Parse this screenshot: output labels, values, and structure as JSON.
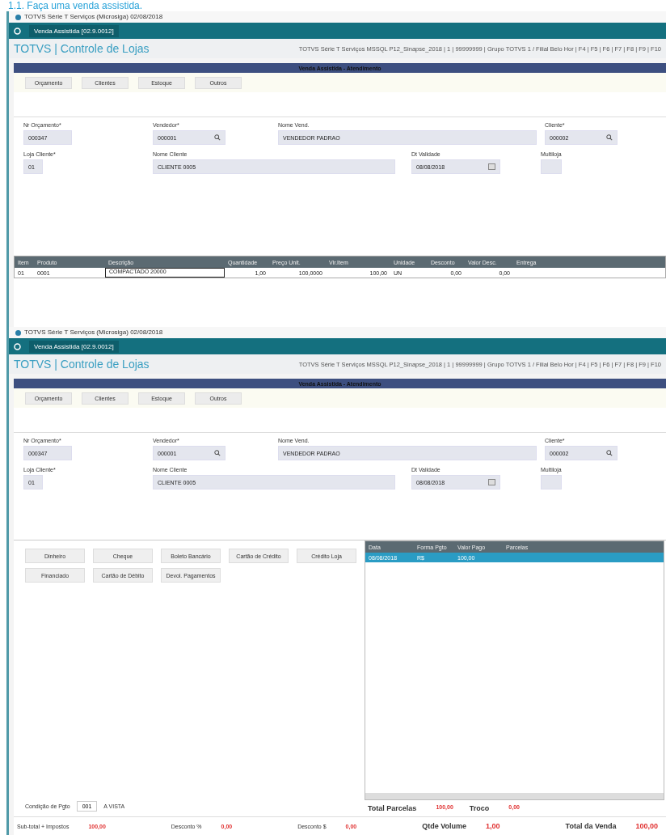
{
  "caption": "1.1. Faça uma venda assistida.",
  "screens": [
    {
      "window_title": "TOTVS Série T Serviços (Microsiga) 02/08/2018",
      "tab": "Venda Assistida [02.9.0012]",
      "app_title": "TOTVS | Controle de Lojas",
      "environment": "TOTVS Série T Serviços MSSQL P12_Sinapse_2018 | 1 | 99999999 | Grupo TOTVS 1 / Filial Belo Hor | F4 | F5 | F6 | F7 | F8 | F9 | F10",
      "dialog_title": "Venda Assistida - Atendimento",
      "toolbar": [
        "Orçamento",
        "Clientes",
        "Estoque",
        "Outros"
      ],
      "field_rows": [
        [
          {
            "label": "Nr Orçamento*",
            "value": "000347",
            "kind": "text"
          },
          {
            "label": "Vendedor*",
            "value": "000001",
            "kind": "lookup"
          },
          {
            "label": "Nome Vend.",
            "value": "VENDEDOR PADRAO",
            "kind": "text"
          },
          {
            "label": "Cliente*",
            "value": "000002",
            "kind": "lookup"
          }
        ],
        [
          {
            "label": "Loja Cliente*",
            "value": "01",
            "kind": "text"
          },
          {
            "label": "Nome Cliente",
            "value": "CLIENTE 0005",
            "kind": "text"
          },
          {
            "label": "Dt Validade",
            "value": "08/08/2018",
            "kind": "date"
          },
          {
            "label": "Multiloja",
            "kind": "text"
          }
        ]
      ],
      "items_table": {
        "columns": [
          "Item",
          "Produto",
          "Descrição",
          "Quantidade",
          "Preço Unit.",
          "Vlr.Item",
          "Unidade",
          "Desconto",
          "Valor Desc.",
          "Entrega"
        ],
        "rows": [
          [
            "01",
            "0001",
            "COMPACTADO 20000",
            "1,00",
            "100,0000",
            "100,00",
            "UN",
            "0,00",
            "0,00",
            ""
          ]
        ]
      }
    },
    {
      "window_title": "TOTVS Série T Serviços (Microsiga) 02/08/2018",
      "tab": "Venda Assistida [02.9.0012]",
      "app_title": "TOTVS | Controle de Lojas",
      "environment": "TOTVS Série T Serviços MSSQL P12_Sinapse_2018 | 1 | 99999999 | Grupo TOTVS 1 / Filial Belo Hor | F4 | F5 | F6 | F7 | F8 | F9 | F10",
      "dialog_title": "Venda Assistida - Atendimento",
      "toolbar": [
        "Orçamento",
        "Clientes",
        "Estoque",
        "Outros"
      ],
      "field_rows": [
        [
          {
            "label": "Nr Orçamento*",
            "value": "000347",
            "kind": "text"
          },
          {
            "label": "Vendedor*",
            "value": "000001",
            "kind": "lookup"
          },
          {
            "label": "Nome Vend.",
            "value": "VENDEDOR PADRAO",
            "kind": "text"
          },
          {
            "label": "Cliente*",
            "value": "000002",
            "kind": "lookup"
          }
        ],
        [
          {
            "label": "Loja Cliente*",
            "value": "01",
            "kind": "text"
          },
          {
            "label": "Nome Cliente",
            "value": "CLIENTE 0005",
            "kind": "text"
          },
          {
            "label": "Dt Validade",
            "value": "08/08/2018",
            "kind": "date"
          },
          {
            "label": "Multiloja",
            "kind": "text"
          }
        ]
      ],
      "payment": {
        "buttons": [
          [
            "Dinheiro",
            "Cheque",
            "Boleto Bancário",
            "Cartão de Crédito",
            "Crédito Loja"
          ],
          [
            "Financiado",
            "Cartão de Débito",
            "Devol. Pagamentos"
          ]
        ],
        "columns": [
          "Data",
          "Forma Pgto",
          "Valor Pago",
          "Parcelas"
        ],
        "rows": [
          {
            "cells": [
              "08/08/2018",
              "R$",
              "100,00",
              ""
            ],
            "selected": true
          }
        ],
        "condition_label": "Condição de Pgto",
        "condition_code": "001",
        "condition_name": "A VISTA",
        "total_parcelas": {
          "label": "Total Parcelas",
          "value": "100,00"
        },
        "troco": {
          "label": "Troco",
          "value": "0,00"
        }
      },
      "totals": [
        {
          "label": "Sub-total + Impostos",
          "value": "100,00",
          "big": false
        },
        {
          "label": "Desconto %",
          "value": "0,00",
          "big": false
        },
        {
          "label": "Desconto $",
          "value": "0,00",
          "big": false
        },
        {
          "label": "Qtde Volume",
          "value": "1,00",
          "big": true
        },
        {
          "label": "Total da Venda",
          "value": "100,00",
          "big": true
        }
      ]
    }
  ]
}
